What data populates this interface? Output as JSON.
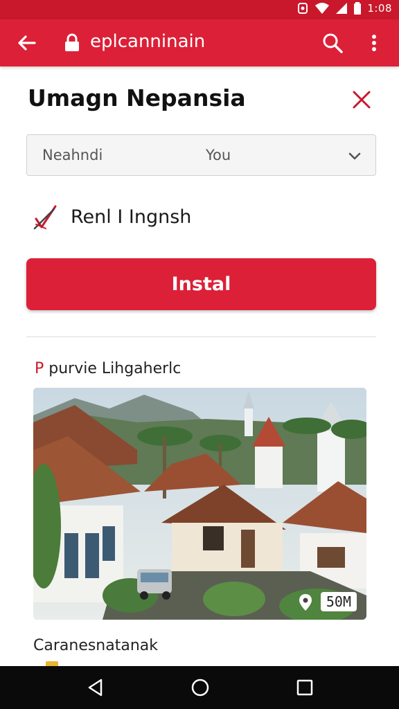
{
  "status_bar": {
    "time": "1:08"
  },
  "app_bar": {
    "url": "eplcanninain"
  },
  "dialog": {
    "title": "Umagn Nepansia",
    "select": {
      "left_text": "Neahndi",
      "value": "You"
    },
    "checkbox_label": "Renl I Ingnsh",
    "install_label": "Instal"
  },
  "preview": {
    "title_accent": "P",
    "title_rest": " purvie Lihgaherlc",
    "size": "50M"
  },
  "caption": "Caranesnatanak",
  "colors": {
    "brand_red": "#dc2037",
    "status_red": "#c9182b",
    "nav_black": "#0a0a0a"
  }
}
